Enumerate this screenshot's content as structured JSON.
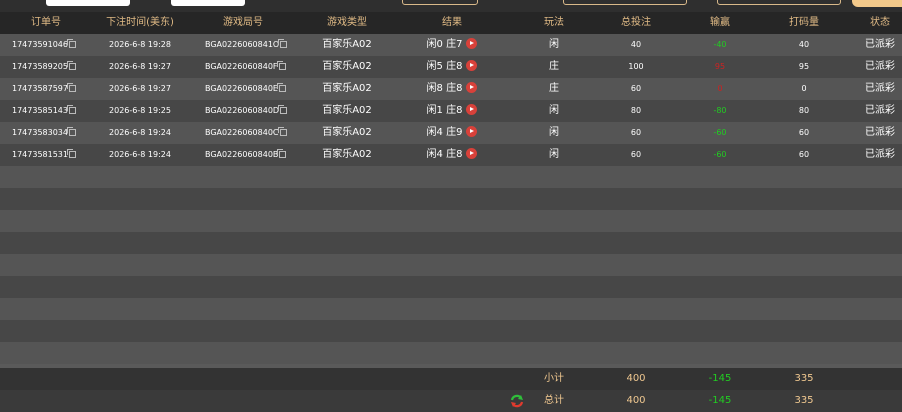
{
  "columns": [
    "订单号",
    "下注时间(美东)",
    "游戏局号",
    "游戏类型",
    "结果",
    "玩法",
    "总投注",
    "输赢",
    "打码量",
    "状态"
  ],
  "rows": [
    {
      "order": "17473591046",
      "time": "2026-6-8 19:28",
      "round": "BGA0226060841O",
      "game": "百家乐A02",
      "result": "闲0 庄7",
      "bet_type": "闲",
      "total": "40",
      "winloss": "-40",
      "winloss_color": "#22cc22",
      "turnover": "40",
      "status": "已派彩"
    },
    {
      "order": "17473589205",
      "time": "2026-6-8 19:27",
      "round": "BGA0226060840F",
      "game": "百家乐A02",
      "result": "闲5 庄8",
      "bet_type": "庄",
      "total": "100",
      "winloss": "95",
      "winloss_color": "#cc2222",
      "turnover": "95",
      "status": "已派彩"
    },
    {
      "order": "17473587597",
      "time": "2026-6-8 19:27",
      "round": "BGA0226060840E",
      "game": "百家乐A02",
      "result": "闲8 庄8",
      "bet_type": "庄",
      "total": "60",
      "winloss": "0",
      "winloss_color": "#cc2222",
      "turnover": "0",
      "status": "已派彩"
    },
    {
      "order": "17473585143",
      "time": "2026-6-8 19:25",
      "round": "BGA0226060840D",
      "game": "百家乐A02",
      "result": "闲1 庄8",
      "bet_type": "闲",
      "total": "80",
      "winloss": "-80",
      "winloss_color": "#22cc22",
      "turnover": "80",
      "status": "已派彩"
    },
    {
      "order": "17473583034",
      "time": "2026-6-8 19:24",
      "round": "BGA0226060840C",
      "game": "百家乐A02",
      "result": "闲4 庄9",
      "bet_type": "闲",
      "total": "60",
      "winloss": "-60",
      "winloss_color": "#22cc22",
      "turnover": "60",
      "status": "已派彩"
    },
    {
      "order": "17473581531",
      "time": "2026-6-8 19:24",
      "round": "BGA0226060840B",
      "game": "百家乐A02",
      "result": "闲4 庄8",
      "bet_type": "闲",
      "total": "60",
      "winloss": "-60",
      "winloss_color": "#22cc22",
      "turnover": "60",
      "status": "已派彩"
    }
  ],
  "subtotal": {
    "label": "小计",
    "total": "400",
    "winloss": "-145",
    "turnover": "335"
  },
  "grandtotal": {
    "label": "总计",
    "total": "400",
    "winloss": "-145",
    "turnover": "335"
  },
  "colors": {
    "header_text": "#e0ba85",
    "footer_text": "#f0c890",
    "loss_green": "#22cc22",
    "win_red": "#cc2222",
    "accent_button": "#f3c98a"
  },
  "icons": {
    "copy": "copy-icon",
    "play": "play-icon",
    "refresh": "refresh-icon"
  }
}
